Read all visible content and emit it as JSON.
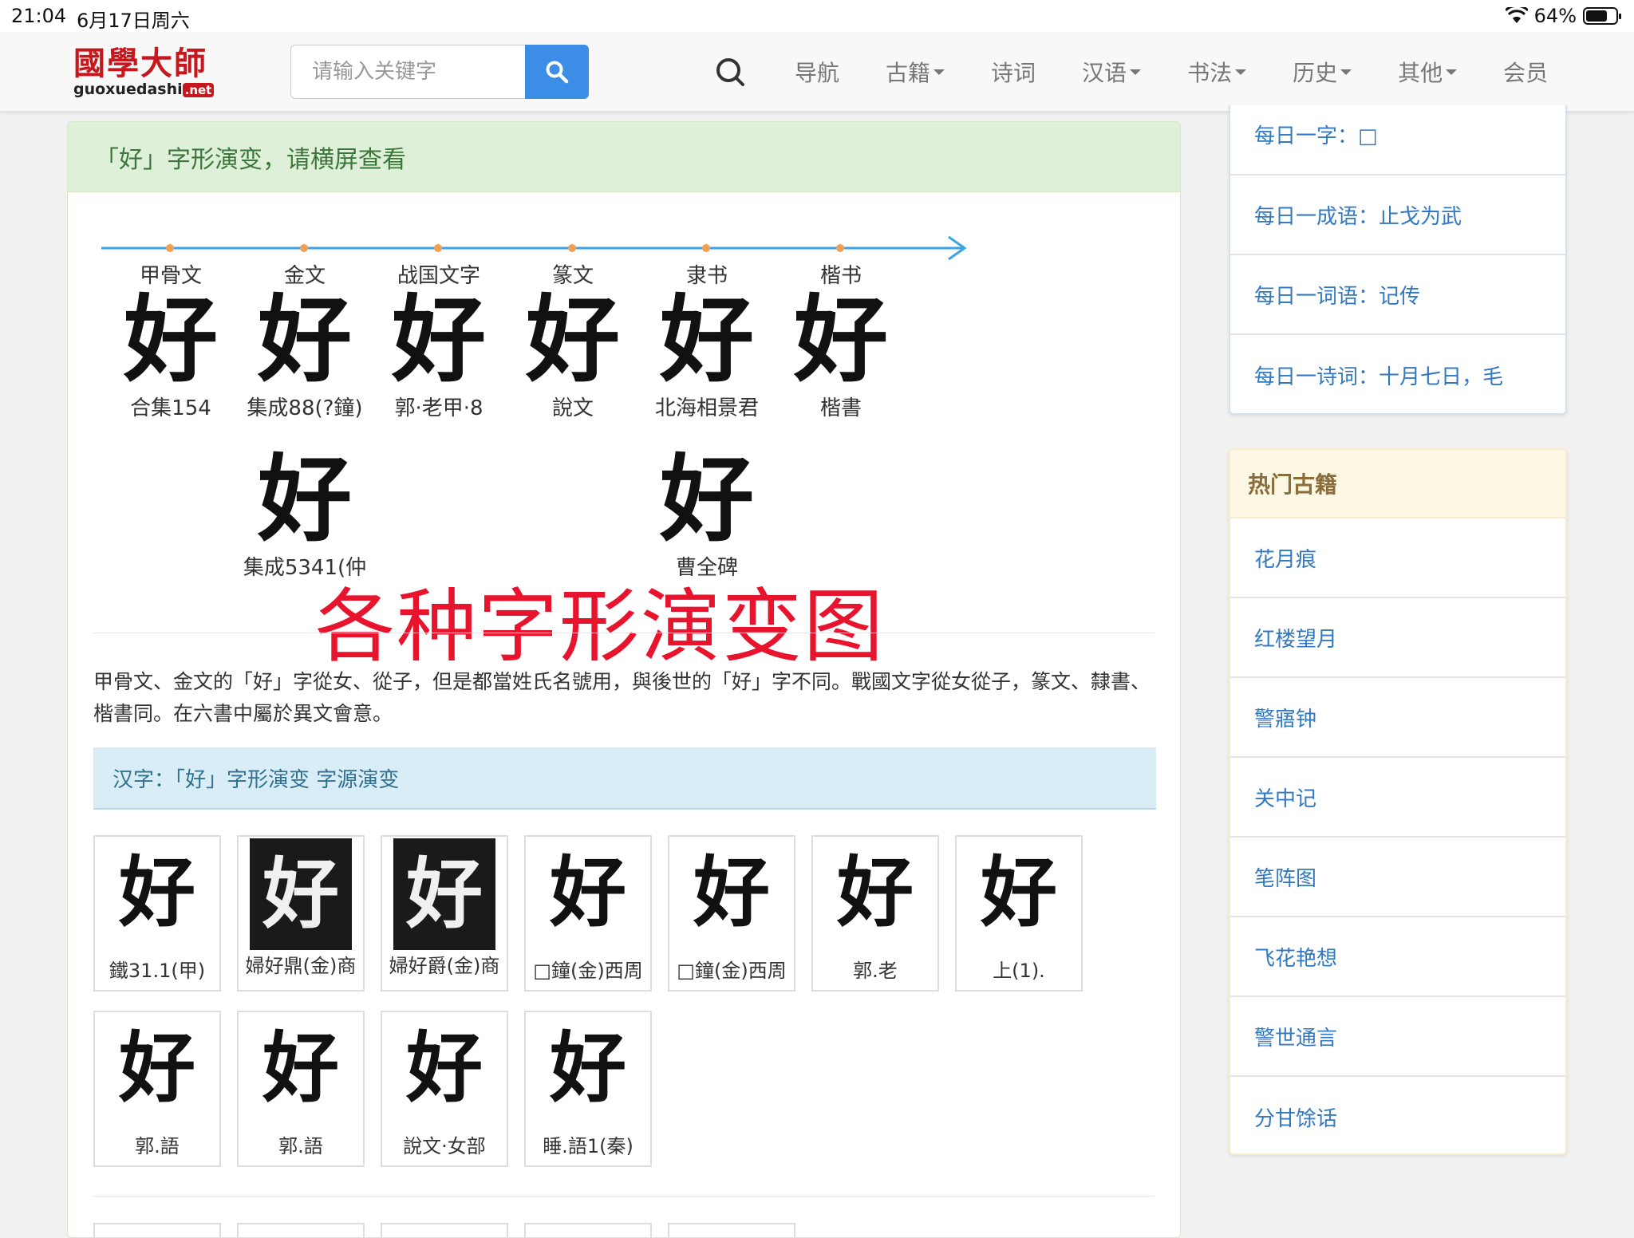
{
  "status": {
    "time": "21:04",
    "date": "6月17日周六",
    "battery": "64%"
  },
  "logo": {
    "cn": "國學大師",
    "en": "guoxuedashi",
    "net": ".net"
  },
  "search": {
    "placeholder": "请输入关键字"
  },
  "nav": [
    "导航",
    "古籍",
    "诗词",
    "汉语",
    "书法",
    "历史",
    "其他",
    "会员"
  ],
  "panel": {
    "title": "「好」字形演变，请横屏查看"
  },
  "evolution": {
    "stages": [
      "甲骨文",
      "金文",
      "战国文字",
      "篆文",
      "隶书",
      "楷书"
    ],
    "row1": [
      {
        "glyph": "好",
        "caption": "合集154"
      },
      {
        "glyph": "好",
        "caption": "集成88(?鐘)"
      },
      {
        "glyph": "好",
        "caption": "郭·老甲·8"
      },
      {
        "glyph": "好",
        "caption": "說文"
      },
      {
        "glyph": "好",
        "caption": "北海相景君"
      },
      {
        "glyph": "好",
        "caption": "楷書"
      }
    ],
    "row2": [
      {
        "glyph": "好",
        "caption": "集成5341(仲"
      },
      {
        "glyph": "好",
        "caption": "曹全碑"
      }
    ]
  },
  "overlay_text": "各种字形演变图",
  "description": "甲骨文、金文的「好」字從女、從子，但是都當姓氏名號用，與後世的「好」字不同。戰國文字從女從子，篆文、隸書、楷書同。在六書中屬於異文會意。",
  "subhead": "汉字：「好」字形演变 字源演变",
  "tiles_row1": [
    {
      "glyph": "好",
      "caption": "鐵31.1(甲)"
    },
    {
      "glyph": "好",
      "caption": "婦好鼎(金)商"
    },
    {
      "glyph": "好",
      "caption": "婦好爵(金)商"
    },
    {
      "glyph": "好",
      "caption": "□鐘(金)西周"
    },
    {
      "glyph": "好",
      "caption": "□鐘(金)西周"
    },
    {
      "glyph": "好",
      "caption": "郭.老"
    },
    {
      "glyph": "好",
      "caption": "上(1)."
    }
  ],
  "tiles_row2": [
    {
      "glyph": "好",
      "caption": "郭.語"
    },
    {
      "glyph": "好",
      "caption": "郭.語"
    },
    {
      "glyph": "好",
      "caption": "說文·女部"
    },
    {
      "glyph": "好",
      "caption": "睡.語1(秦)"
    }
  ],
  "daily": [
    "每日一字：□",
    "每日一成语：止戈为武",
    "每日一词语：记传",
    "每日一诗词：十月七日，毛"
  ],
  "hot_books": {
    "title": "热门古籍",
    "items": [
      "花月痕",
      "红楼望月",
      "警寤钟",
      "关中记",
      "笔阵图",
      "飞花艳想",
      "警世通言",
      "分甘馀话"
    ]
  },
  "colors": {
    "accent_blue": "#3b8de6",
    "logo_red": "#c8161d",
    "overlay_red": "#e8132d",
    "link_blue": "#3379c1"
  }
}
